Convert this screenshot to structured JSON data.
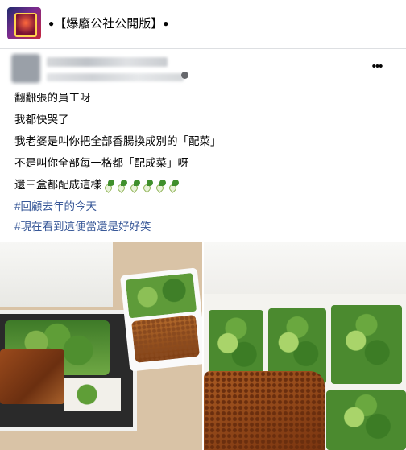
{
  "header": {
    "title_dot_left": "●",
    "title": "【爆廢公社公開版】",
    "title_dot_right": "●"
  },
  "post": {
    "more_icon": "more-options-icon",
    "lines": [
      "翻飜張的員工呀",
      "我都快哭了",
      "我老婆是叫你把全部香腸換成別的「配菜」",
      "不是叫你全部每一格都「配成菜」呀",
      "還三盒都配成這樣"
    ],
    "emoji_count_label": "bok-choy-emoji x6",
    "hashtags": [
      "#回顧去年的今天",
      "#現在看到這便當還是好好笑"
    ]
  },
  "photos": {
    "left_icon": "bento-photo-left",
    "right_icon": "bento-photo-right"
  },
  "colors": {
    "hashtag": "#385898",
    "text": "#050505",
    "border": "#dddfe2"
  }
}
